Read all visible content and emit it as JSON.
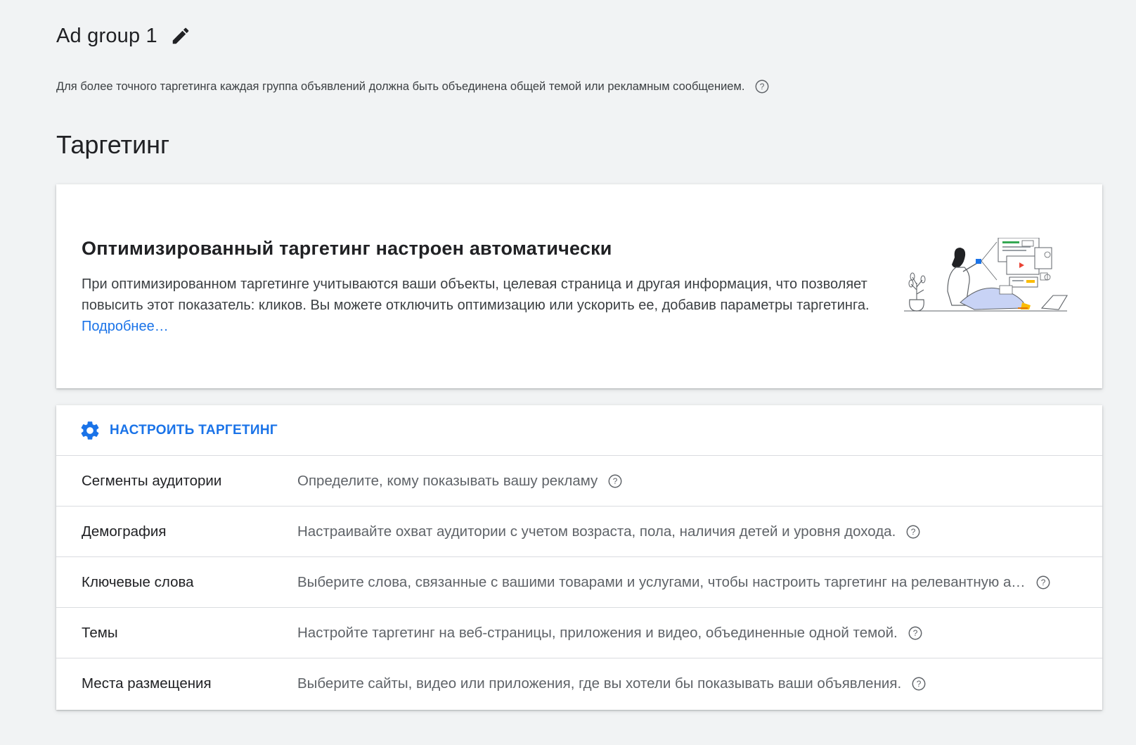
{
  "header": {
    "title": "Ad group 1",
    "edit_icon": "pencil-icon"
  },
  "subtitle": {
    "text": "Для более точного таргетинга каждая группа объявлений должна быть объединена общей темой или рекламным сообщением.",
    "help_icon": "help-circle-icon"
  },
  "section": {
    "title": "Таргетинг"
  },
  "promo": {
    "heading": "Оптимизированный таргетинг настроен автоматически",
    "body": "При оптимизированном таргетинге учитываются ваши объекты, целевая страница и другая информация, что позволяет повысить этот показатель: кликов. Вы можете отключить оптимизацию или ускорить ее, добавив параметры таргетинга.",
    "link": "Подробнее…",
    "illustration": "person-with-ads-illustration"
  },
  "targeting": {
    "configure_label": "НАСТРОИТЬ ТАРГЕТИНГ",
    "configure_icon": "gear-icon",
    "rows": [
      {
        "name": "Сегменты аудитории",
        "description": "Определите, кому показывать вашу рекламу"
      },
      {
        "name": "Демография",
        "description": "Настраивайте охват аудитории с учетом возраста, пола, наличия детей и уровня дохода."
      },
      {
        "name": "Ключевые слова",
        "description": "Выберите слова, связанные с вашими товарами и услугами, чтобы настроить таргетинг на релевантную аудиторию."
      },
      {
        "name": "Темы",
        "description": "Настройте таргетинг на веб-страницы, приложения и видео, объединенные одной темой."
      },
      {
        "name": "Места размещения",
        "description": "Выберите сайты, видео или приложения, где вы хотели бы показывать ваши объявления."
      }
    ]
  },
  "colors": {
    "background": "#f1f3f4",
    "accent": "#1a73e8",
    "text_primary": "#202124",
    "text_secondary": "#5f6368"
  }
}
